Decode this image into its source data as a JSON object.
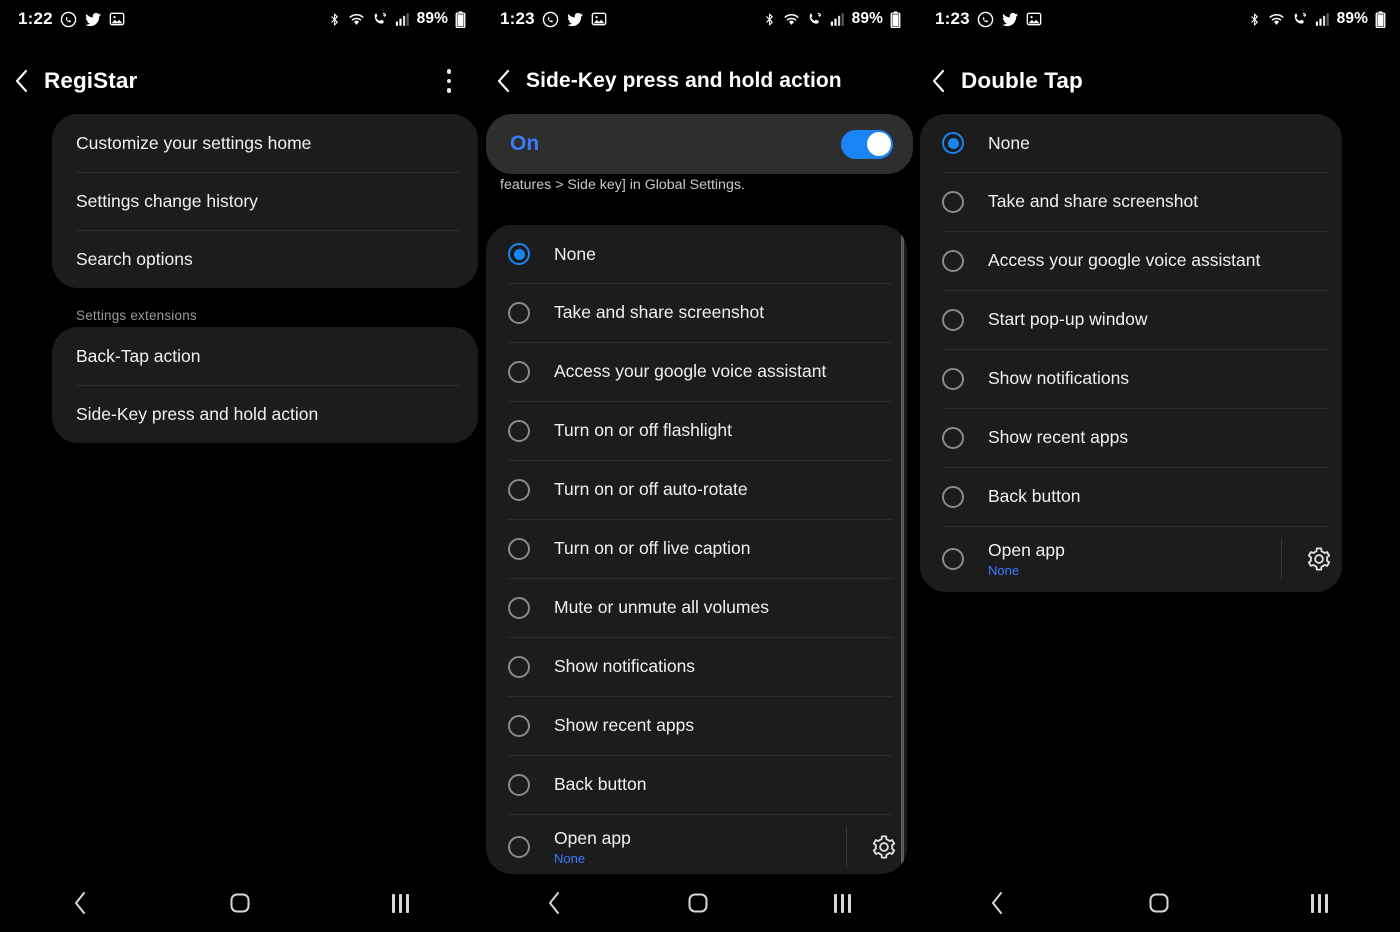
{
  "meta": {
    "accent_blue": "#1a84f5",
    "link_blue": "#3a7bfc",
    "card_bg": "#1c1c1c",
    "toggle_card_bg": "#2e2e2e",
    "screen_bg": "#000000"
  },
  "panels": [
    {
      "id": "registar",
      "status_bar": {
        "time": "1:22",
        "battery": "89%",
        "left_icons": [
          "whatsapp-icon",
          "twitter-icon",
          "gallery-icon"
        ],
        "right_icons": [
          "bluetooth-icon",
          "wifi-icon",
          "call-icon",
          "signal-icon",
          "battery-icon"
        ]
      },
      "app_bar": {
        "title": "RegiStar",
        "back_icon": "back-chevron-icon",
        "overflow_icon": "overflow-menu-icon"
      },
      "groups": [
        {
          "label": "",
          "items": [
            "Customize your settings home",
            "Settings change history",
            "Search options"
          ]
        },
        {
          "label": "Settings extensions",
          "items": [
            "Back-Tap action",
            "Side-Key press and hold action"
          ]
        }
      ],
      "nav_bar": {
        "back": "back-icon",
        "home": "home-icon",
        "recents": "recents-icon"
      }
    },
    {
      "id": "side-key",
      "status_bar": {
        "time": "1:23",
        "battery": "89%",
        "left_icons": [
          "whatsapp-icon",
          "twitter-icon",
          "gallery-icon"
        ],
        "right_icons": [
          "bluetooth-icon",
          "wifi-icon",
          "call-icon",
          "signal-icon",
          "battery-icon"
        ]
      },
      "app_bar": {
        "title": "Side-Key press and hold action",
        "back_icon": "back-chevron-icon"
      },
      "master_toggle": {
        "label": "On",
        "state": "on"
      },
      "helper_text": "This settings has priority over the menu [Settings > Advanced features > Side key] in Global Settings.",
      "options": [
        {
          "label": "None",
          "selected": true
        },
        {
          "label": "Take and share screenshot",
          "selected": false
        },
        {
          "label": "Access your google voice assistant",
          "selected": false
        },
        {
          "label": "Turn on or off flashlight",
          "selected": false
        },
        {
          "label": "Turn on or off auto-rotate",
          "selected": false
        },
        {
          "label": "Turn on or off live caption",
          "selected": false
        },
        {
          "label": "Mute or unmute all volumes",
          "selected": false
        },
        {
          "label": "Show notifications",
          "selected": false
        },
        {
          "label": "Show recent apps",
          "selected": false
        },
        {
          "label": "Back button",
          "selected": false
        },
        {
          "label": "Open app",
          "sub": "None",
          "selected": false,
          "accessory": "gear-icon"
        }
      ],
      "nav_bar": {
        "back": "back-icon",
        "home": "home-icon",
        "recents": "recents-icon"
      }
    },
    {
      "id": "double-tap",
      "status_bar": {
        "time": "1:23",
        "battery": "89%",
        "left_icons": [
          "whatsapp-icon",
          "twitter-icon",
          "gallery-icon"
        ],
        "right_icons": [
          "bluetooth-icon",
          "wifi-icon",
          "call-icon",
          "signal-icon",
          "battery-icon"
        ]
      },
      "app_bar": {
        "title": "Double Tap",
        "back_icon": "back-chevron-icon"
      },
      "options": [
        {
          "label": "None",
          "selected": true
        },
        {
          "label": "Take and share screenshot",
          "selected": false
        },
        {
          "label": "Access your google voice assistant",
          "selected": false
        },
        {
          "label": "Start pop-up window",
          "selected": false
        },
        {
          "label": "Show notifications",
          "selected": false
        },
        {
          "label": "Show recent apps",
          "selected": false
        },
        {
          "label": "Back button",
          "selected": false
        },
        {
          "label": "Open app",
          "sub": "None",
          "selected": false,
          "accessory": "gear-icon"
        }
      ],
      "nav_bar": {
        "back": "back-icon",
        "home": "home-icon",
        "recents": "recents-icon"
      }
    }
  ]
}
